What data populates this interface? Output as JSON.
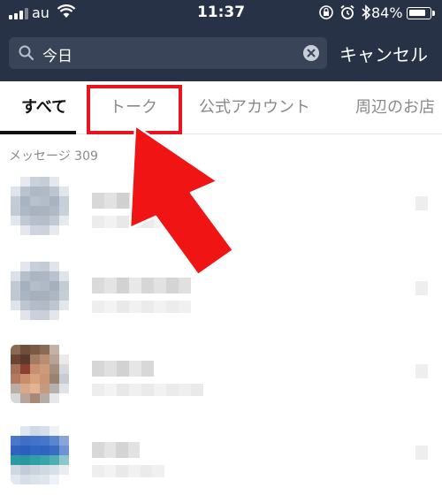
{
  "status_bar": {
    "carrier": "au",
    "time": "11:37",
    "battery_percent_text": "84%",
    "battery_level": 0.84,
    "icons": [
      "signal-icon",
      "wifi-icon",
      "rotation-lock-icon",
      "alarm-icon",
      "bluetooth-icon",
      "battery-icon"
    ]
  },
  "search": {
    "query": "今日",
    "cancel_label": "キャンセル"
  },
  "tabs": [
    {
      "label": "すべて",
      "active": true
    },
    {
      "label": "トーク",
      "active": false
    },
    {
      "label": "公式アカウント",
      "active": false
    },
    {
      "label": "周辺のお店",
      "active": false
    }
  ],
  "section": {
    "title": "メッセージ 309"
  },
  "colors": {
    "header_bg": "#283247",
    "search_bg": "#3a4459",
    "highlight": "#e8141e",
    "arrow": "#f01414"
  }
}
